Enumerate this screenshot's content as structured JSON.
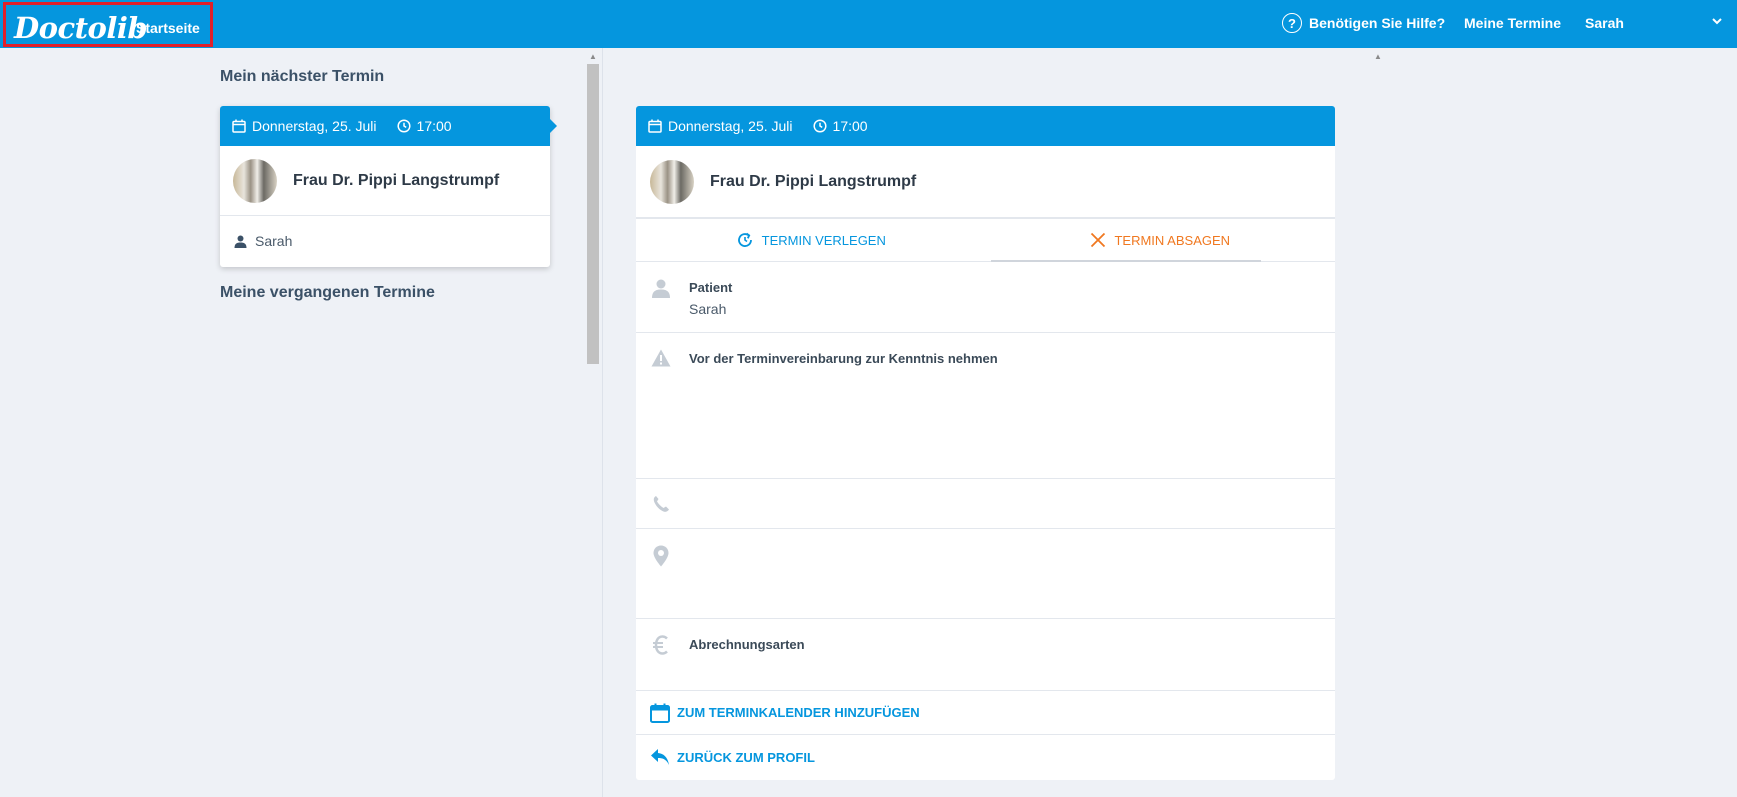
{
  "header": {
    "logo": "Doctolib",
    "home": "Startseite",
    "help": "Benötigen Sie Hilfe?",
    "help_icon": "?",
    "appointments": "Meine Termine",
    "user": "Sarah"
  },
  "left": {
    "next_title": "Mein nächster Termin",
    "past_title": "Meine vergangenen Termine",
    "card": {
      "date": "Donnerstag, 25. Juli",
      "time": "17:00",
      "doctor": "Frau Dr. Pippi Langstrumpf",
      "patient": "Sarah"
    }
  },
  "detail": {
    "date": "Donnerstag, 25. Juli",
    "time": "17:00",
    "doctor": "Frau Dr. Pippi Langstrumpf",
    "move": "TERMIN VERLEGEN",
    "cancel": "TERMIN ABSAGEN",
    "patient_label": "Patient",
    "patient_value": "Sarah",
    "notice_label": "Vor der Terminvereinbarung zur Kenntnis nehmen",
    "billing_label": "Abrechnungsarten",
    "add_calendar": "ZUM TERMINKALENDER HINZUFÜGEN",
    "back_profile": "ZURÜCK ZUM PROFIL"
  },
  "colors": {
    "brand": "#0596de",
    "cancel": "#f07820",
    "highlight": "#e0202a"
  }
}
